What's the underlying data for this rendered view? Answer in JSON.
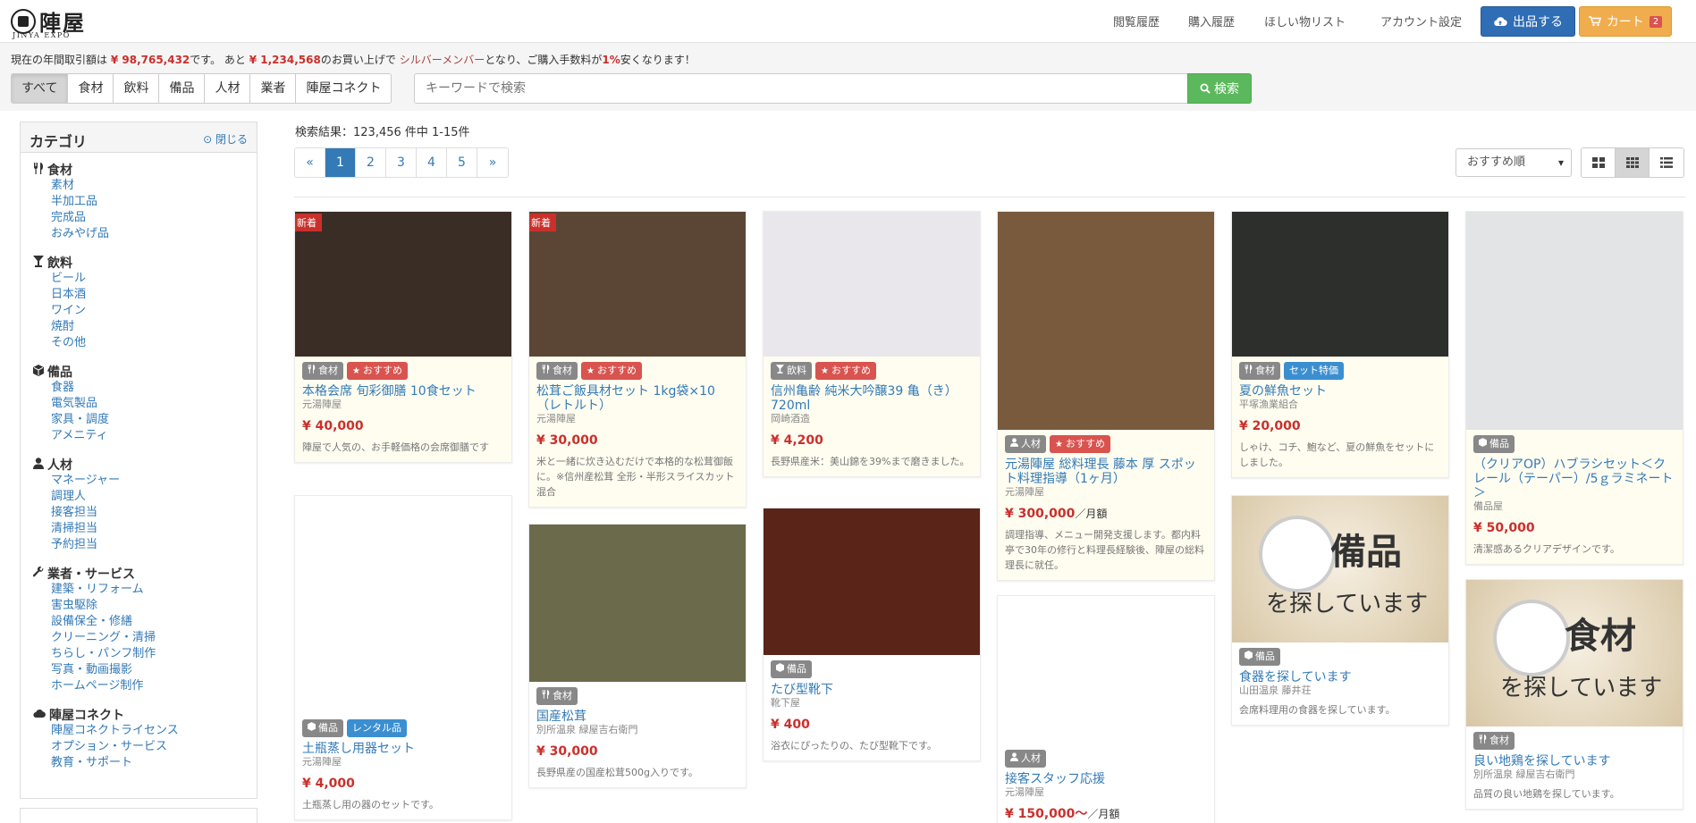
{
  "header": {
    "logo_kanji": "陣屋",
    "logo_sub": "JINYA EXPO",
    "nav": [
      "閲覧履歴",
      "購入履歴",
      "ほしい物リスト",
      "アカウント設定"
    ],
    "sell_label": "出品する",
    "cart_label": "カート",
    "cart_count": "2"
  },
  "notice": {
    "p1": "現在の年間取引額は",
    "amount": "¥ 98,765,432",
    "p2": "です。 あと",
    "remaining": "¥ 1,234,568",
    "p3": "のお買い上げで",
    "level": "シルバーメンバー",
    "p4": "となり、ご購入手数料が",
    "rate": "1%",
    "p5": "安くなります！"
  },
  "tabs": [
    "すべて",
    "食材",
    "飲料",
    "備品",
    "人材",
    "業者",
    "陣屋コネクト"
  ],
  "search": {
    "placeholder": "キーワードで検索",
    "button": "検索"
  },
  "sidebar": {
    "title": "カテゴリ",
    "close": "閉じる",
    "groups": [
      {
        "name": "食材",
        "icon": "utensils-icon",
        "items": [
          "素材",
          "半加工品",
          "完成品",
          "おみやげ品"
        ]
      },
      {
        "name": "飲料",
        "icon": "glass-icon",
        "items": [
          "ビール",
          "日本酒",
          "ワイン",
          "焼酎",
          "その他"
        ]
      },
      {
        "name": "備品",
        "icon": "cube-icon",
        "items": [
          "食器",
          "電気製品",
          "家具・調度",
          "アメニティ"
        ]
      },
      {
        "name": "人材",
        "icon": "user-icon",
        "items": [
          "マネージャー",
          "調理人",
          "接客担当",
          "清掃担当",
          "予約担当"
        ]
      },
      {
        "name": "業者・サービス",
        "icon": "wrench-icon",
        "items": [
          "建築・リフォーム",
          "害虫駆除",
          "設備保全・修繕",
          "クリーニング・清掃",
          "ちらし・パンフ制作",
          "写真・動画撮影",
          "ホームページ制作"
        ]
      },
      {
        "name": "陣屋コネクト",
        "icon": "cloud-icon",
        "items": [
          "陣屋コネクトライセンス",
          "オプション・サービス",
          "教育・サポート"
        ]
      }
    ]
  },
  "results": {
    "text": "検索結果：123,456 件中 1-15件"
  },
  "pager": [
    "«",
    "1",
    "2",
    "3",
    "4",
    "5",
    "»"
  ],
  "sort": {
    "selected": "おすすめ順"
  },
  "products": [
    {
      "title": "本格会席 旬彩御膳 10食セット",
      "seller": "元湯陣屋",
      "price": "¥ 40,000",
      "unit": "",
      "desc": "陣屋で人気の、お手軽価格の会席御膳です",
      "badges": [
        "食材",
        "おすすめ"
      ],
      "new": "新着",
      "img_color": "#3a2d26"
    },
    {
      "title": "松茸ご飯具材セット 1kg袋×10（レトルト）",
      "seller": "元湯陣屋",
      "price": "¥ 30,000",
      "unit": "",
      "desc": "米と一緒に炊き込むだけで本格的な松茸御飯に。※信州産松茸 全形・半形スライスカット混合",
      "badges": [
        "食材",
        "おすすめ"
      ],
      "new": "新着",
      "img_color": "#5b4636"
    },
    {
      "title": "信州亀齢 純米大吟醸39 亀（き）720ml",
      "seller": "岡崎酒造",
      "price": "¥ 4,200",
      "unit": "",
      "desc": "長野県産米：美山錦を39%まで磨きました。",
      "badges": [
        "飲料",
        "おすすめ"
      ],
      "img_color": "#e9e7ec"
    },
    {
      "title": "元湯陣屋 総料理長 藤本 厚 スポット料理指導（1ヶ月）",
      "seller": "元湯陣屋",
      "price": "¥ 300,000",
      "unit": "／月額",
      "desc": "調理指導、メニュー開発支援します。都内料亭で30年の修行と料理長経験後、陣屋の総料理長に就任。",
      "badges": [
        "人材",
        "おすすめ"
      ],
      "img_color": "#7a5a3c"
    },
    {
      "title": "夏の鮮魚セット",
      "seller": "平塚漁業組合",
      "price": "¥ 20,000",
      "unit": "",
      "desc": "しゃけ、コチ、鮑など、夏の鮮魚をセットにしました。",
      "badges": [
        "食材",
        "セット特価"
      ],
      "img_color": "#2c2f2c"
    },
    {
      "title": "（クリアOP）ハブラシセット＜クレール（テーパー）/5ｇラミネート＞",
      "seller": "備品屋",
      "price": "¥ 50,000",
      "unit": "",
      "desc": "清潔感あるクリアデザインです。",
      "badges": [
        "備品"
      ],
      "img_color": "#e2e4e6"
    },
    {
      "title": "土瓶蒸し用器セット",
      "seller": "元湯陣屋",
      "price": "¥ 4,000",
      "unit": "",
      "desc": "土瓶蒸し用の器のセットです。",
      "badges": [
        "備品",
        "レンタル品"
      ],
      "img_color": "#ffffff"
    },
    {
      "title": "国産松茸",
      "seller": "別所温泉 緑屋吉右衛門",
      "price": "¥ 30,000",
      "unit": "",
      "desc": "長野県産の国産松茸500g入りです。",
      "badges": [
        "食材"
      ],
      "img_color": "#6b6a4a"
    },
    {
      "title": "たび型靴下",
      "seller": "靴下屋",
      "price": "¥ 400",
      "unit": "",
      "desc": "浴衣にぴったりの、たび型靴下です。",
      "badges": [
        "備品"
      ],
      "img_color": "#5a2418"
    },
    {
      "title": "接客スタッフ応援",
      "seller": "元湯陣屋",
      "price": "¥ 150,000～",
      "unit": "／月額",
      "desc": "",
      "badges": [
        "人材"
      ],
      "img_color": "#ffffff"
    },
    {
      "title": "食器を探しています",
      "seller": "山田温泉 藤井荘",
      "price": "",
      "unit": "",
      "desc": "会席料理用の食器を探しています。",
      "badges": [
        "備品"
      ],
      "img_color": "#e9dcc4",
      "poster": "備品",
      "poster_sub": "を探しています"
    },
    {
      "title": "良い地鶏を探しています",
      "seller": "別所温泉 緑屋吉右衛門",
      "price": "",
      "unit": "",
      "desc": "品質の良い地鶏を探しています。",
      "badges": [
        "食材"
      ],
      "img_color": "#e9dcc4",
      "poster": "食材",
      "poster_sub": "を探しています"
    }
  ]
}
